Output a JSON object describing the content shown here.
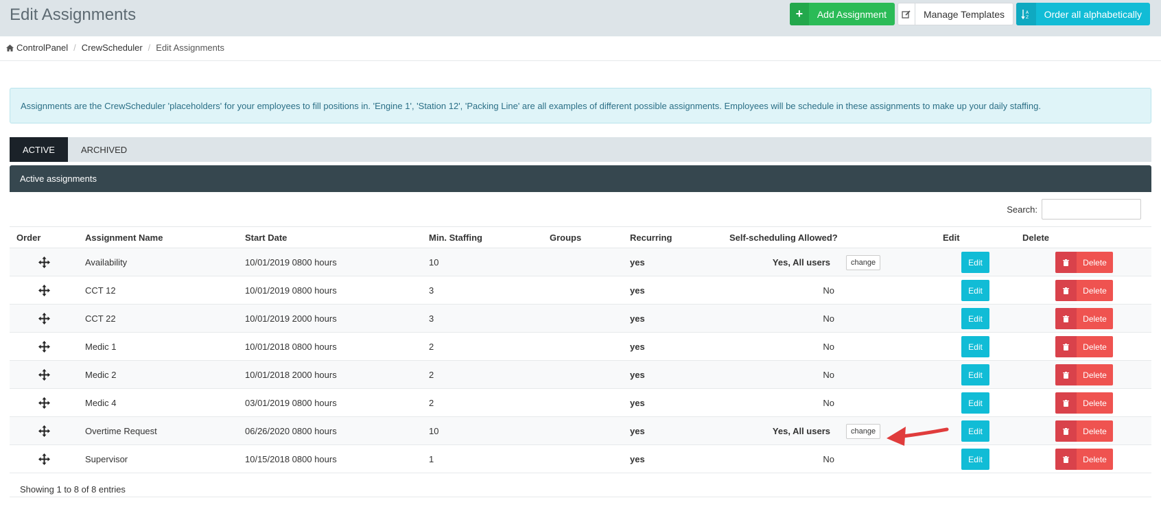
{
  "header": {
    "title": "Edit Assignments",
    "add_label": "Add Assignment",
    "templates_label": "Manage Templates",
    "order_label": "Order all alphabetically"
  },
  "breadcrumb": [
    "ControlPanel",
    "CrewScheduler",
    "Edit Assignments"
  ],
  "alert": "Assignments are the CrewScheduler 'placeholders' for your employees to fill positions in. 'Engine 1', 'Station 12', 'Packing Line' are all examples of different possible assignments. Employees will be schedule in these assignments to make up your daily staffing.",
  "tabs": [
    {
      "label": "ACTIVE",
      "active": true
    },
    {
      "label": "ARCHIVED",
      "active": false
    }
  ],
  "panel_title": "Active assignments",
  "search_label": "Search:",
  "columns": [
    "Order",
    "Assignment Name",
    "Start Date",
    "Min. Staffing",
    "Groups",
    "Recurring",
    "Self-scheduling Allowed?",
    "Edit",
    "Delete"
  ],
  "rows": [
    {
      "name": "Availability",
      "start": "10/01/2019 0800 hours",
      "min": "10",
      "groups": "",
      "recurring": "yes",
      "self": "Yes, All users",
      "change": "change"
    },
    {
      "name": "CCT 12",
      "start": "10/01/2019 0800 hours",
      "min": "3",
      "groups": "",
      "recurring": "yes",
      "self": "No",
      "change": ""
    },
    {
      "name": "CCT 22",
      "start": "10/01/2019 2000 hours",
      "min": "3",
      "groups": "",
      "recurring": "yes",
      "self": "No",
      "change": ""
    },
    {
      "name": "Medic 1",
      "start": "10/01/2018 0800 hours",
      "min": "2",
      "groups": "",
      "recurring": "yes",
      "self": "No",
      "change": ""
    },
    {
      "name": "Medic 2",
      "start": "10/01/2018 2000 hours",
      "min": "2",
      "groups": "",
      "recurring": "yes",
      "self": "No",
      "change": ""
    },
    {
      "name": "Medic 4",
      "start": "03/01/2019 0800 hours",
      "min": "2",
      "groups": "",
      "recurring": "yes",
      "self": "No",
      "change": ""
    },
    {
      "name": "Overtime Request",
      "start": "06/26/2020 0800 hours",
      "min": "10",
      "groups": "",
      "recurring": "yes",
      "self": "Yes, All users",
      "change": "change"
    },
    {
      "name": "Supervisor",
      "start": "10/15/2018 0800 hours",
      "min": "1",
      "groups": "",
      "recurring": "yes",
      "self": "No",
      "change": ""
    }
  ],
  "edit_label": "Edit",
  "delete_label": "Delete",
  "footer": "Showing 1 to 8 of 8 entries",
  "colors": {
    "green": "#2bbb57",
    "cyan": "#11bcd6",
    "red": "#ef5350",
    "dark": "#36474f"
  }
}
